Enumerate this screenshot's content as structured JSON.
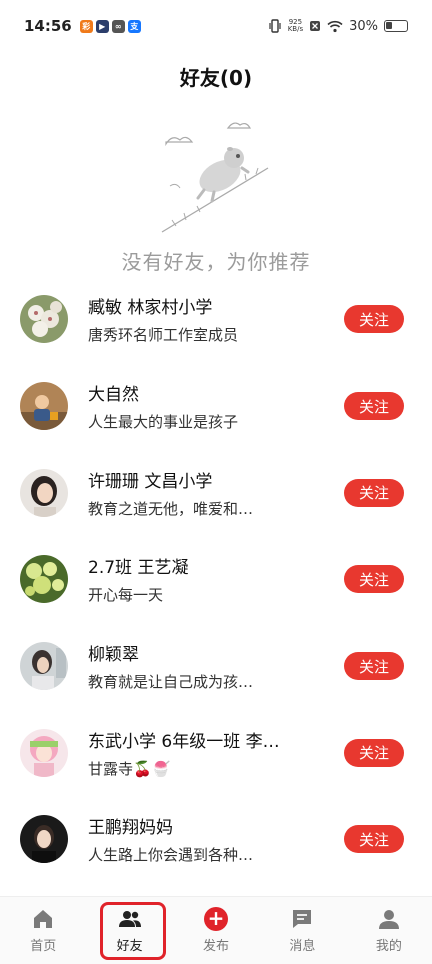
{
  "status_bar": {
    "time": "14:56",
    "net_speed_top": "925",
    "net_speed_bottom": "KB/s",
    "battery": "30%",
    "app_badges": [
      {
        "icon": "app-icon-orange",
        "text": "彩",
        "color": "#f07a1a"
      },
      {
        "icon": "app-icon-dark",
        "text": "▶",
        "color": "#2c3e6b"
      },
      {
        "icon": "app-icon-link",
        "text": "∞",
        "color": "#555555"
      },
      {
        "icon": "app-icon-alipay",
        "text": "支",
        "color": "#1677ff"
      }
    ]
  },
  "header": {
    "title": "好友(0)"
  },
  "empty_state": {
    "message": "没有好友，为你推荐"
  },
  "follow_label": "关注",
  "users": [
    {
      "name": "臧敏 林家村小学",
      "desc": "唐秀环名师工作室成员",
      "avatar": "avatar-flowers"
    },
    {
      "name": "大自然",
      "desc": "人生最大的事业是孩子",
      "avatar": "avatar-child"
    },
    {
      "name": "许珊珊 文昌小学",
      "desc": "教育之道无他，唯爱和…",
      "avatar": "avatar-woman"
    },
    {
      "name": "2.7班 王艺凝",
      "desc": "开心每一天",
      "avatar": "avatar-green-flowers"
    },
    {
      "name": "柳颖翠",
      "desc": "教育就是让自己成为孩…",
      "avatar": "avatar-girl"
    },
    {
      "name": "东武小学 6年级一班 李…",
      "desc": "甘露寺🍒🍧",
      "avatar": "avatar-anime"
    },
    {
      "name": "王鹏翔妈妈",
      "desc": "人生路上你会遇到各种…",
      "avatar": "avatar-portrait"
    }
  ],
  "bottom_nav": [
    {
      "label": "首页",
      "icon": "home-icon"
    },
    {
      "label": "好友",
      "icon": "friends-icon",
      "active": true
    },
    {
      "label": "发布",
      "icon": "publish-icon"
    },
    {
      "label": "消息",
      "icon": "message-icon"
    },
    {
      "label": "我的",
      "icon": "profile-icon"
    }
  ]
}
